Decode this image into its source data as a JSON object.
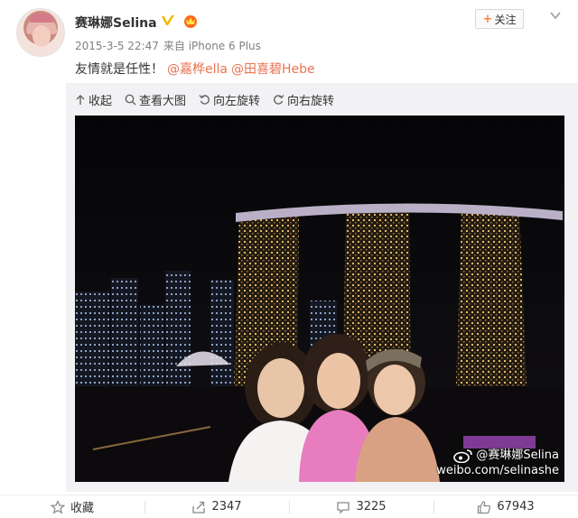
{
  "post": {
    "user_name": "赛琳娜Selina",
    "timestamp": "2015-3-5 22:47",
    "source": "来自 iPhone 6 Plus",
    "text": "友情就是任性！",
    "mentions": [
      "@嘉桦ella",
      "@田喜碧Hebe"
    ],
    "follow_label": "关注"
  },
  "media_toolbar": {
    "collapse": "收起",
    "view_large": "查看大图",
    "rotate_left": "向左旋转",
    "rotate_right": "向右旋转"
  },
  "photo": {
    "watermark_name": "@赛琳娜Selina",
    "watermark_url": "weibo.com/selinashe"
  },
  "actions": {
    "favorite": "收藏",
    "reposts": "2347",
    "comments": "3225",
    "likes": "67943"
  },
  "colors": {
    "accent_orange": "#eb7350",
    "verified_gold": "#f5b700",
    "text": "#333333",
    "meta": "#808080"
  },
  "icons": [
    "verified-icon",
    "member-crown-icon",
    "dropdown-chevron-icon",
    "collapse-arrow-icon",
    "search-icon",
    "rotate-left-icon",
    "rotate-right-icon",
    "star-icon",
    "repost-icon",
    "comment-icon",
    "like-icon"
  ]
}
